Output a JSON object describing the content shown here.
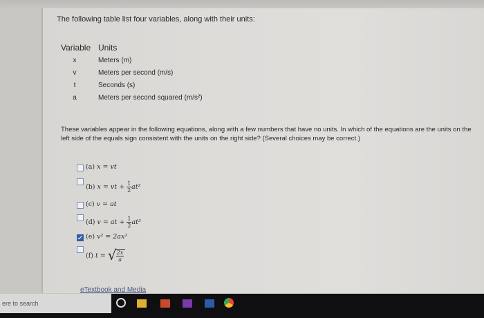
{
  "intro_text": "The following table list four variables, along with their units:",
  "table": {
    "headers": [
      "Variable",
      "Units"
    ],
    "rows": [
      {
        "variable": "x",
        "units": "Meters (m)"
      },
      {
        "variable": "v",
        "units": "Meters per second (m/s)"
      },
      {
        "variable": "t",
        "units": "Seconds (s)"
      },
      {
        "variable": "a",
        "units": "Meters per second squared (m/s²)"
      }
    ]
  },
  "question_text": "These variables appear in the following equations, along with a few numbers that have no units. In which of the equations are the units on the left side of the equals sign consistent with the units on the right side? (Several choices may be correct.)",
  "choices": [
    {
      "label": "(a)",
      "equation": "x = vt",
      "checked": false
    },
    {
      "label": "(b)",
      "equation": "x = vt + ½at²",
      "checked": false
    },
    {
      "label": "(c)",
      "equation": "v = at",
      "checked": false
    },
    {
      "label": "(d)",
      "equation": "v = at + ½at³",
      "checked": false
    },
    {
      "label": "(e)",
      "equation": "v² = 2ax²",
      "checked": true
    },
    {
      "label": "(f)",
      "equation": "t = √(2x/a)",
      "checked": false
    }
  ],
  "math": {
    "one": "1",
    "two": "2",
    "two_x": "2x",
    "a": "a",
    "b_lhs": "x = vt + ",
    "b_rhs": "at²",
    "d_lhs": "v = at + ",
    "d_rhs": "at³",
    "f_lhs": "t = ",
    "radical": "√"
  },
  "footer_link": "eTextbook and Media",
  "taskbar": {
    "search_placeholder": "ere to search",
    "icons": [
      "cortana-icon",
      "file-explorer-icon",
      "powerpoint-icon",
      "onenote-icon",
      "word-icon",
      "chrome-icon"
    ]
  },
  "colors": {
    "checkbox_checked": "#2f5fa8",
    "link": "#4a5a80"
  }
}
